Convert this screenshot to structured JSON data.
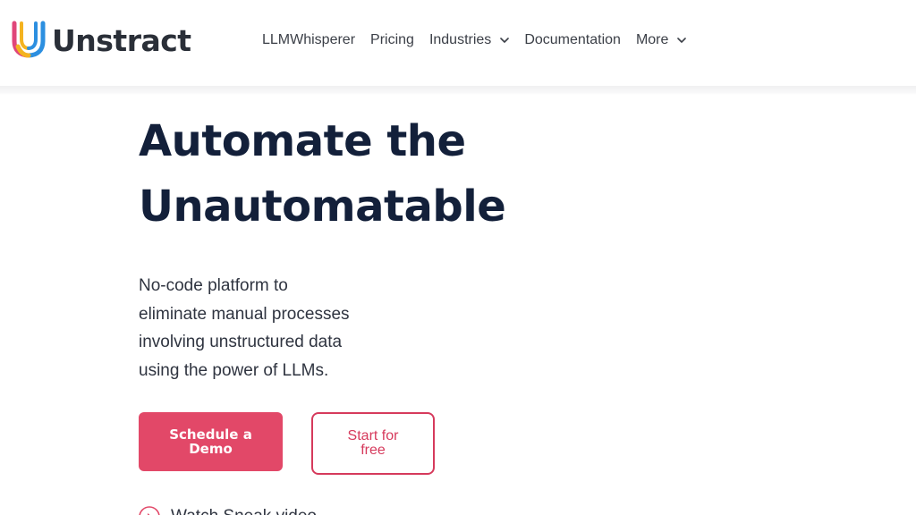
{
  "brand": {
    "name": "Unstract",
    "colors": {
      "logo_pink": "#e0467a",
      "logo_yellow": "#f4b320",
      "logo_blue": "#2c8fe0",
      "accent": "#e24868"
    }
  },
  "nav": {
    "items": [
      {
        "label": "LLMWhisperer",
        "has_dropdown": false
      },
      {
        "label": "Pricing",
        "has_dropdown": false
      },
      {
        "label": "Industries",
        "has_dropdown": true,
        "icon": "chevron-down-icon"
      },
      {
        "label": "Documentation",
        "has_dropdown": false
      },
      {
        "label": "More",
        "has_dropdown": true,
        "icon": "chevron-down-icon"
      }
    ]
  },
  "hero": {
    "title_line1": "Automate the",
    "title_line2": "Unautomatable",
    "subtitle_lines": [
      "No-code platform to",
      "eliminate manual processes",
      "involving unstructured data",
      "using the power of LLMs."
    ],
    "primary_cta": "Schedule a Demo",
    "secondary_cta": "Start for free",
    "watch_label": "Watch Sneak video",
    "watch_icon": "play-circle-icon"
  }
}
